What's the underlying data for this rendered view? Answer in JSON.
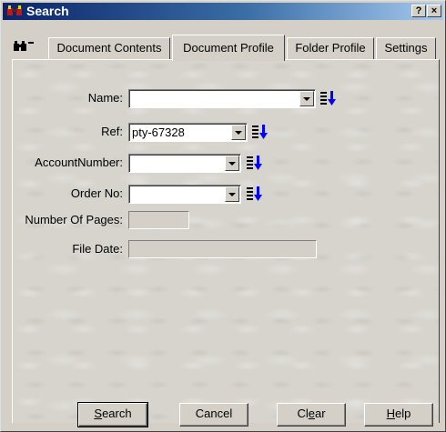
{
  "window": {
    "title": "Search",
    "help_button": "?",
    "close_button": "×"
  },
  "tabs": [
    {
      "label": "Document Contents",
      "active": false
    },
    {
      "label": "Document Profile",
      "active": true
    },
    {
      "label": "Folder Profile",
      "active": false
    },
    {
      "label": "Settings",
      "active": false
    }
  ],
  "form": {
    "name": {
      "label": "Name:",
      "value": ""
    },
    "ref": {
      "label": "Ref:",
      "value": "pty-67328"
    },
    "account_number": {
      "label": "AccountNumber:",
      "value": ""
    },
    "order_no": {
      "label": "Order No:",
      "value": ""
    },
    "number_of_pages": {
      "label": "Number Of Pages:",
      "value": ""
    },
    "file_date": {
      "label": "File Date:",
      "value": ""
    }
  },
  "buttons": {
    "search": {
      "pre": "",
      "key": "S",
      "post": "earch"
    },
    "cancel": {
      "pre": "Cancel",
      "key": "",
      "post": ""
    },
    "clear": {
      "pre": "Cl",
      "key": "e",
      "post": "ar"
    },
    "help": {
      "pre": "",
      "key": "H",
      "post": "elp"
    }
  },
  "icons": {
    "app": "binoculars-icon",
    "tab_strip": "binoculars-icon",
    "sort": "sort-descending-icon"
  },
  "colors": {
    "titlebar_start": "#0a246a",
    "titlebar_end": "#a6caf0",
    "face": "#d4d0c8",
    "sort_arrow": "#0000ff"
  }
}
